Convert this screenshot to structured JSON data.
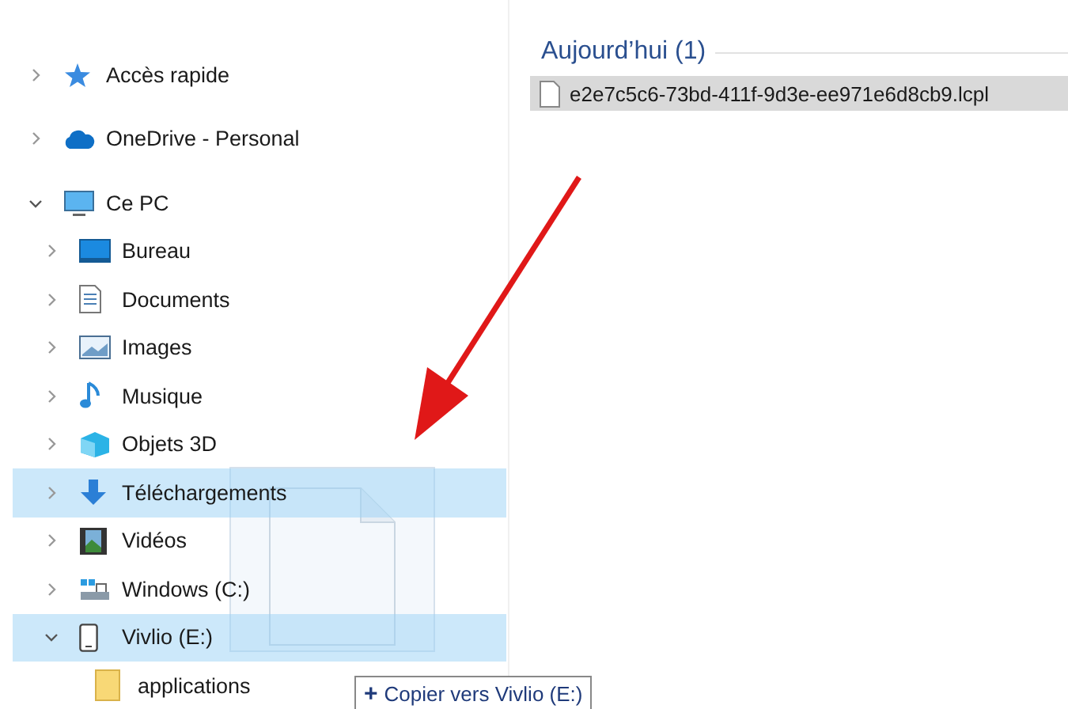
{
  "nav": [
    {
      "label": "Accès rapide",
      "expanded": false,
      "selected": false
    },
    {
      "label": "OneDrive - Personal",
      "expanded": false,
      "selected": false
    },
    {
      "label": "Ce PC",
      "expanded": true,
      "selected": false,
      "children": [
        {
          "label": "Bureau",
          "expanded": false,
          "selected": false
        },
        {
          "label": "Documents",
          "expanded": false,
          "selected": false
        },
        {
          "label": "Images",
          "expanded": false,
          "selected": false
        },
        {
          "label": "Musique",
          "expanded": false,
          "selected": false
        },
        {
          "label": "Objets 3D",
          "expanded": false,
          "selected": false
        },
        {
          "label": "Téléchargements",
          "expanded": false,
          "selected": true
        },
        {
          "label": "Vidéos",
          "expanded": false,
          "selected": false
        },
        {
          "label": "Windows (C:)",
          "expanded": false,
          "selected": false
        },
        {
          "label": "Vivlio (E:)",
          "expanded": true,
          "selected": true,
          "children": [
            {
              "label": "applications",
              "selected": false
            }
          ]
        }
      ]
    }
  ],
  "content": {
    "group_header": "Aujourd’hui (1)",
    "files": [
      {
        "name": "e2e7c5c6-73bd-411f-9d3e-ee971e6d8cb9.lcpl",
        "selected": true
      }
    ]
  },
  "drag_tooltip": {
    "icon": "+",
    "text": "Copier vers Vivlio (E:)"
  }
}
